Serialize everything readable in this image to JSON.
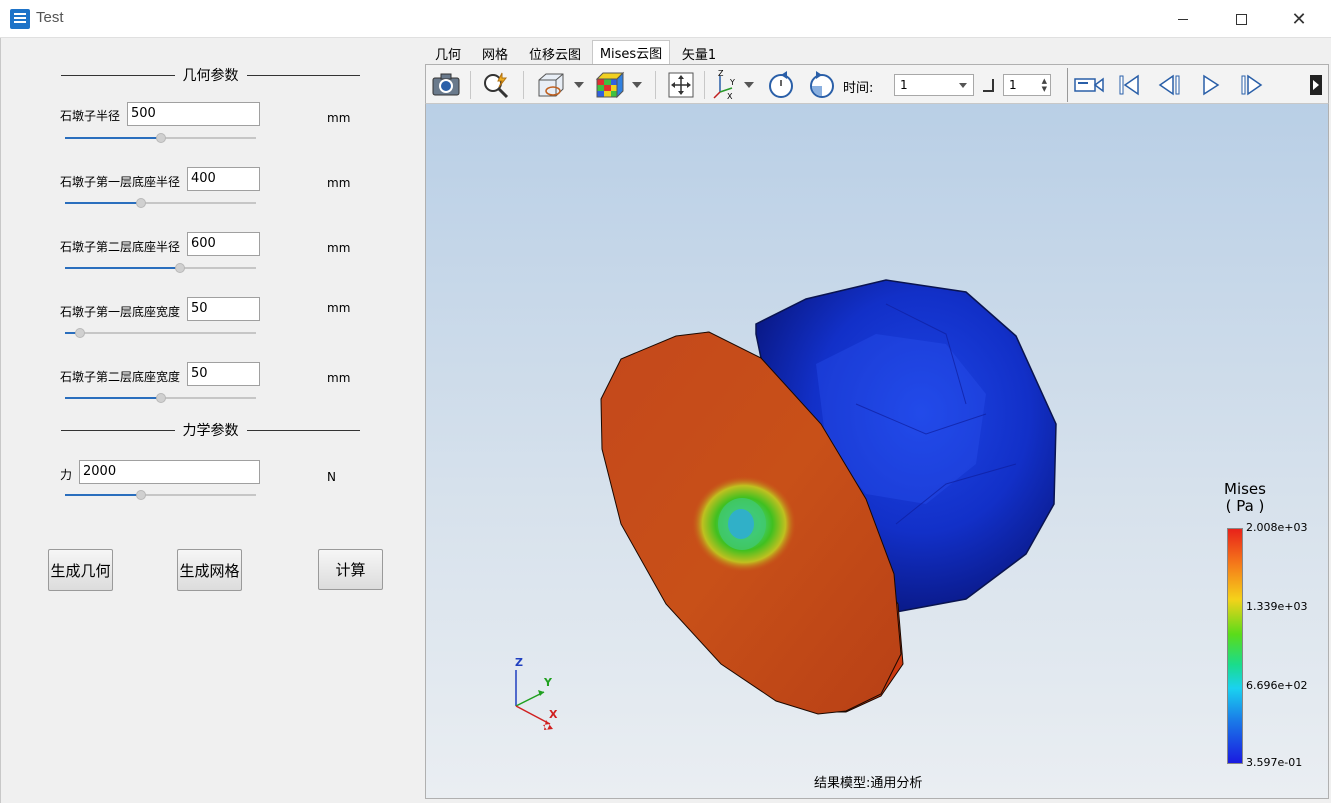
{
  "window": {
    "title": "Test"
  },
  "geometry_section": {
    "title": "几何参数"
  },
  "params": [
    {
      "label": "石墩子半径",
      "value": "500",
      "unit": "mm",
      "slider": 0.5
    },
    {
      "label": "石墩子第一层底座半径",
      "value": "400",
      "unit": "mm",
      "slider": 0.4
    },
    {
      "label": "石墩子第二层底座半径",
      "value": "600",
      "unit": "mm",
      "slider": 0.6
    },
    {
      "label": "石墩子第一层底座宽度",
      "value": "50",
      "unit": "mm",
      "slider": 0.08
    },
    {
      "label": "石墩子第二层底座宽度",
      "value": "50",
      "unit": "mm",
      "slider": 0.5
    }
  ],
  "mechanics_section": {
    "title": "力学参数"
  },
  "force": {
    "label": "力",
    "value": "2000",
    "unit": "N",
    "slider": 0.4
  },
  "buttons": {
    "gen_geometry": "生成几何",
    "gen_mesh": "生成网格",
    "compute": "计算"
  },
  "tabs": [
    {
      "label": "几何",
      "active": false
    },
    {
      "label": "网格",
      "active": false
    },
    {
      "label": "位移云图",
      "active": false
    },
    {
      "label": "Mises云图",
      "active": true
    },
    {
      "label": "矢量1",
      "active": false
    }
  ],
  "toolbar": {
    "time_label": "时间:",
    "time_value": "1",
    "step_value": "1",
    "icons": [
      "camera-icon",
      "zoom-icon",
      "box-view-icon",
      "color-cube-icon",
      "fit-view-icon",
      "axes-icon",
      "rotate-cw-icon",
      "rotate-ccw-icon",
      "record-icon",
      "first-frame-icon",
      "prev-frame-icon",
      "play-icon",
      "next-frame-icon"
    ]
  },
  "legend": {
    "title_line1": "Mises",
    "title_line2": "( Pa )",
    "max": "2.008e+03",
    "mid_high": "1.339e+03",
    "mid_low": "6.696e+02",
    "min": "3.597e-01"
  },
  "axes": {
    "x": "X",
    "y": "Y",
    "z": "Z"
  },
  "status": "结果模型:通用分析"
}
